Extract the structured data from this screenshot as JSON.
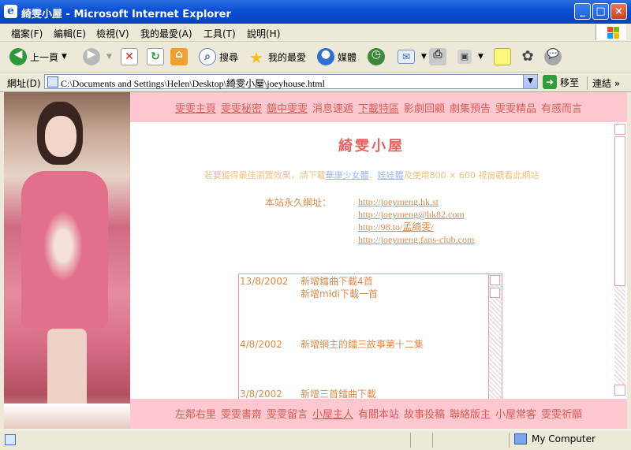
{
  "window": {
    "title": "綺雯小屋 - Microsoft Internet Explorer",
    "controls": [
      "_",
      "□",
      "×"
    ]
  },
  "menu": {
    "items": [
      "檔案(F)",
      "編輯(E)",
      "檢視(V)",
      "我的最愛(A)",
      "工具(T)",
      "說明(H)"
    ]
  },
  "toolbar": {
    "back_label": "上一頁",
    "search_label": "搜尋",
    "favorites_label": "我的最愛",
    "media_label": "媒體"
  },
  "address": {
    "label": "網址(D)",
    "value": "C:\\Documents and Settings\\Helen\\Desktop\\綺雯小屋\\joeyhouse.html",
    "go_label": "移至",
    "links_label": "連結"
  },
  "page": {
    "nav": [
      "雯雯主頁",
      "雯雯秘密",
      "鏡中雯雯",
      "消息速遞",
      "下載特區",
      "影劇回顧",
      "劇集預告",
      "雯雯精品",
      "有感而言"
    ],
    "title": "綺雯小屋",
    "tip": {
      "prefix": "若要獲得最佳瀏覽效果，請下載",
      "link1": "華康少女體",
      "middle": "、",
      "link2": "娃娃體",
      "suffix": "及使用800 × 600 視窗觀看此網站"
    },
    "url_label": "本站永久網址：",
    "urls": [
      "http://joeymeng.hk.st",
      "http://joeymeng@hk82.com",
      "http://98.to/孟綺雯/",
      "http://joeymeng.fans-club.com"
    ],
    "news": [
      {
        "date": "13/8/2002",
        "lines": [
          "新增鐳曲下載4首",
          "新增midi下載一首"
        ]
      },
      {
        "date": "4/8/2002",
        "lines": [
          "新增網主的鐳三故事第十二集"
        ]
      },
      {
        "date": "3/8/2002",
        "lines": [
          "新增三首鐳曲下載"
        ]
      }
    ],
    "footer": [
      "左鄰右里",
      "雯雯書齋",
      "雯雯留言",
      "小屋主人",
      "有關本站",
      "故事投稿",
      "聯絡版主",
      "小屋常客",
      "雯雯祈願"
    ]
  },
  "status": {
    "zone": "My Computer"
  },
  "colors": {
    "nav_bg": "#ffc8d0",
    "nav_text": "#d95c55",
    "title_color": "#e86060",
    "accent_orange": "#e08a4a"
  }
}
